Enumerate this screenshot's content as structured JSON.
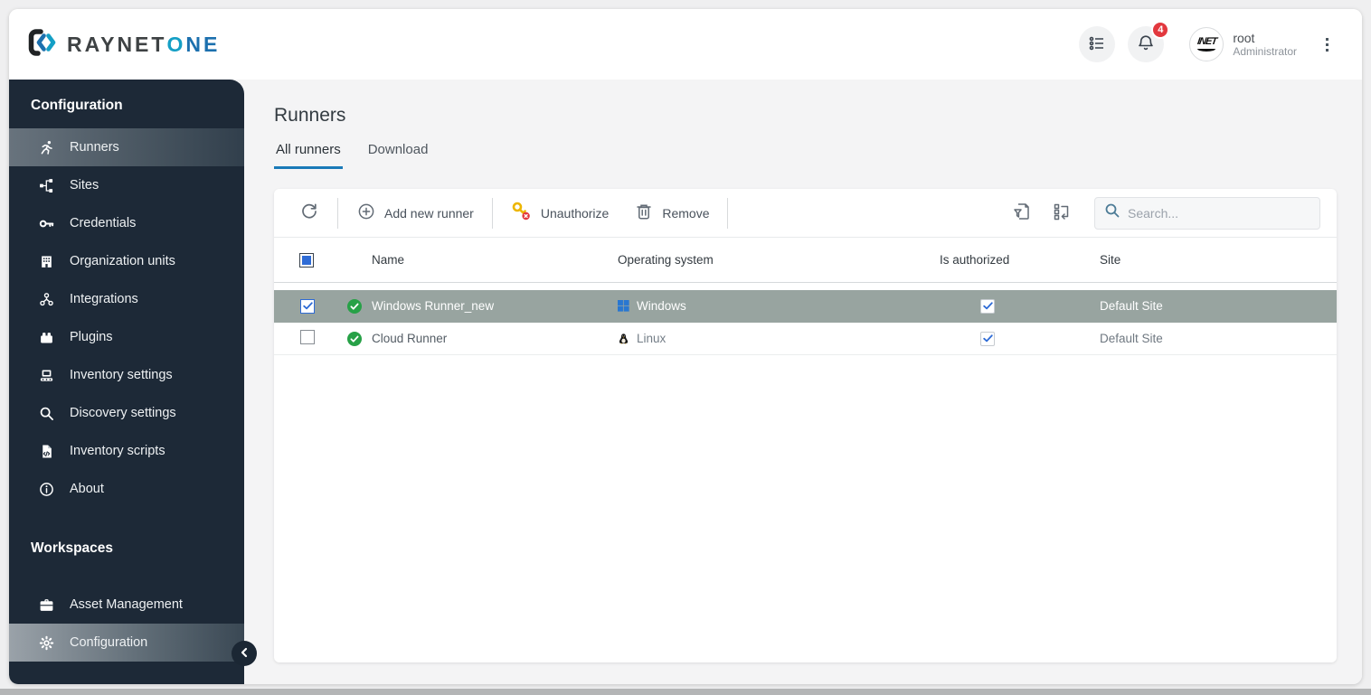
{
  "header": {
    "logo_primary": "RAYNET",
    "logo_accent_o": "O",
    "logo_accent_ne": "NE",
    "notification_count": "4",
    "user": {
      "name": "root",
      "role": "Administrator",
      "avatar_text": "INET"
    }
  },
  "sidebar": {
    "sections": [
      {
        "title": "Configuration",
        "items": [
          {
            "label": "Runners",
            "icon": "runner-icon",
            "active": true
          },
          {
            "label": "Sites",
            "icon": "sitemap-icon",
            "active": false
          },
          {
            "label": "Credentials",
            "icon": "key-icon",
            "active": false
          },
          {
            "label": "Organization units",
            "icon": "building-icon",
            "active": false
          },
          {
            "label": "Integrations",
            "icon": "integrations-icon",
            "active": false
          },
          {
            "label": "Plugins",
            "icon": "plugin-icon",
            "active": false
          },
          {
            "label": "Inventory settings",
            "icon": "inventory-icon",
            "active": false
          },
          {
            "label": "Discovery settings",
            "icon": "magnifier-icon",
            "active": false
          },
          {
            "label": "Inventory scripts",
            "icon": "script-icon",
            "active": false
          },
          {
            "label": "About",
            "icon": "info-icon",
            "active": false
          }
        ]
      },
      {
        "title": "Workspaces",
        "items": [
          {
            "label": "Asset Management",
            "icon": "briefcase-icon",
            "active": false
          },
          {
            "label": "Configuration",
            "icon": "gear-icon",
            "active": true
          }
        ]
      }
    ]
  },
  "main": {
    "title": "Runners",
    "tabs": [
      {
        "label": "All runners",
        "active": true
      },
      {
        "label": "Download",
        "active": false
      }
    ],
    "toolbar": {
      "add_label": "Add new runner",
      "unauthorize_label": "Unauthorize",
      "remove_label": "Remove",
      "search_placeholder": "Search..."
    },
    "table": {
      "columns": [
        "Name",
        "Operating system",
        "Is authorized",
        "Site"
      ],
      "rows": [
        {
          "selected": true,
          "checked": true,
          "status": "ok",
          "name": "Windows Runner_new",
          "os": "Windows",
          "os_icon": "windows-icon",
          "authorized": true,
          "site": "Default Site"
        },
        {
          "selected": false,
          "checked": false,
          "status": "ok",
          "name": "Cloud Runner",
          "os": "Linux",
          "os_icon": "linux-icon",
          "authorized": true,
          "site": "Default Site"
        }
      ]
    }
  },
  "colors": {
    "accent_blue": "#1a7ab8",
    "sidebar_bg": "#1d2937",
    "selected_row": "#98a4a0",
    "badge_red": "#e2383e",
    "status_green": "#27a147",
    "key_yellow": "#edb600",
    "windows_blue": "#2977d1"
  }
}
